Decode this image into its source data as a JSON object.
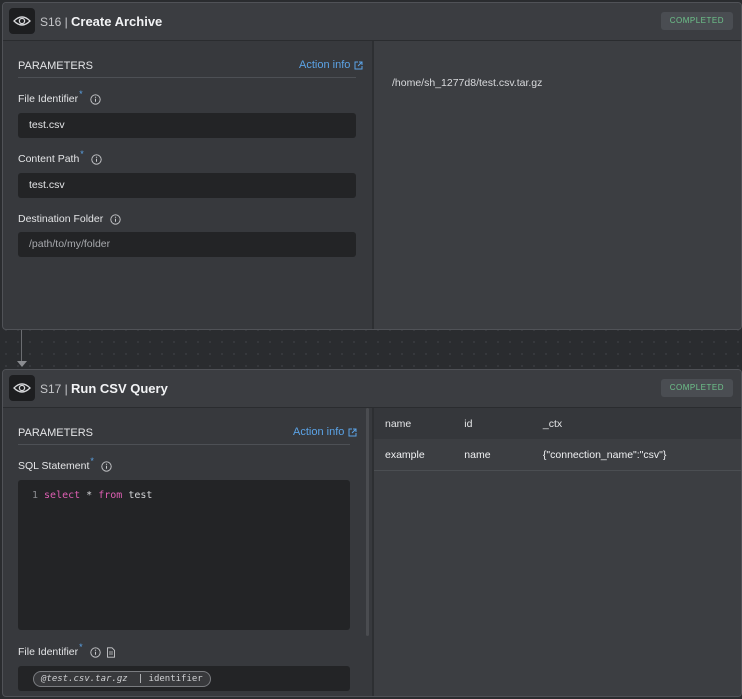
{
  "steps": [
    {
      "id": "S16 |",
      "title": "Create Archive",
      "status": "COMPLETED",
      "params_label": "PARAMETERS",
      "action_info": "Action info",
      "fields": [
        {
          "label": "File Identifier",
          "value": "test.csv"
        },
        {
          "label": "Content Path",
          "value": "test.csv"
        },
        {
          "label": "Destination Folder",
          "placeholder": "/path/to/my/folder"
        }
      ],
      "output": "/home/sh_1277d8/test.csv.tar.gz"
    },
    {
      "id": "S17 |",
      "title": "Run CSV Query",
      "status": "COMPLETED",
      "params_label": "PARAMETERS",
      "action_info": "Action info",
      "sql_label": "SQL Statement",
      "sql": {
        "line_number": "1",
        "keyword1": "select",
        "middle": " * ",
        "keyword2": "from",
        "rest": " test"
      },
      "file_label": "File Identifier",
      "file_value": {
        "variable": "@test.csv.tar.gz",
        "filter": "| identifier"
      },
      "results": {
        "columns": [
          "name",
          "id",
          "_ctx"
        ],
        "rows": [
          [
            "example",
            "name",
            "{\"connection_name\":\"csv\"}"
          ]
        ]
      }
    }
  ],
  "icons": [
    "eye-icon",
    "external-link-icon",
    "info-icon",
    "document-icon",
    "arrow-down-icon"
  ],
  "colors": {
    "accent": "#5ba3e6",
    "status": "#6dc28a",
    "keyword": "#e05fb4"
  }
}
